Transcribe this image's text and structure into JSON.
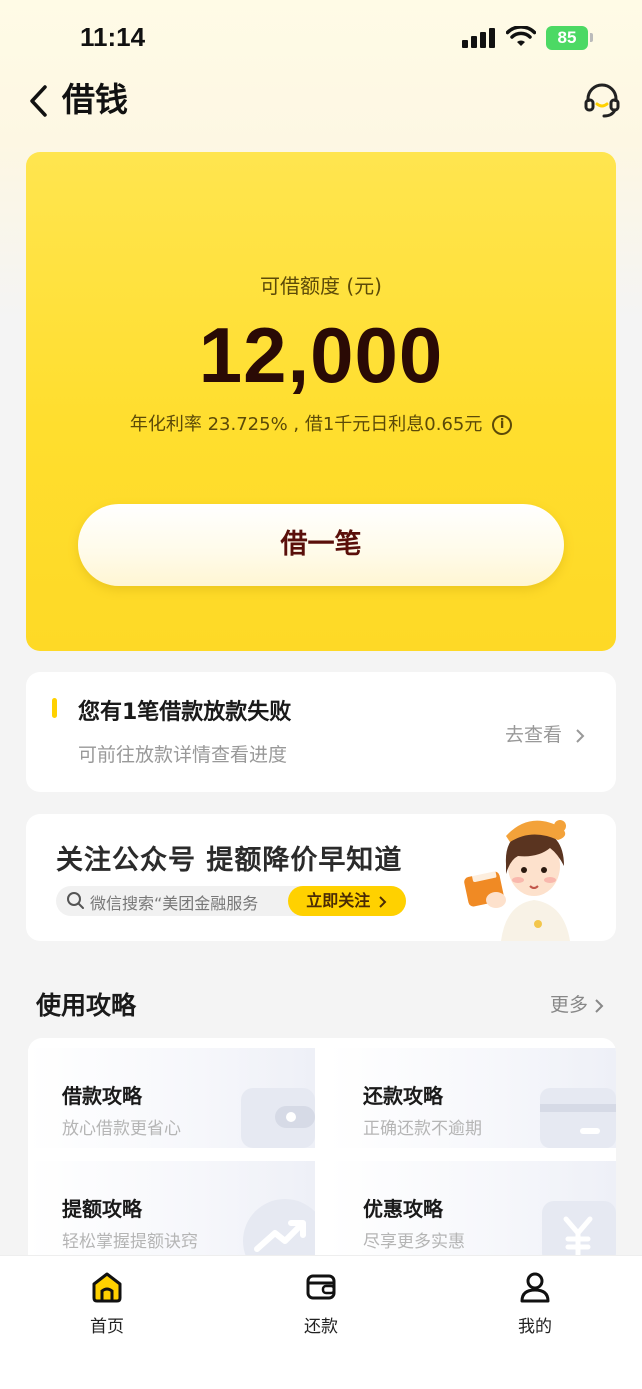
{
  "status_bar": {
    "time": "11:14",
    "battery": "85"
  },
  "nav": {
    "title": "借钱"
  },
  "credit": {
    "label": "可借额度 (元)",
    "amount": "12,000",
    "rate_text": "年化利率 23.725% , 借1千元日利息0.65元",
    "borrow_button": "借一笔"
  },
  "notice": {
    "title": "您有1笔借款放款失败",
    "subtitle": "可前往放款详情查看进度",
    "link": "去查看"
  },
  "banner": {
    "title": "关注公众号 提额降价早知道",
    "search_text": "微信搜索“美团金融服务",
    "follow_button": "立即关注"
  },
  "guides": {
    "section_title": "使用攻略",
    "more": "更多",
    "items": [
      {
        "title": "借款攻略",
        "subtitle": "放心借款更省心"
      },
      {
        "title": "还款攻略",
        "subtitle": "正确还款不逾期"
      },
      {
        "title": "提额攻略",
        "subtitle": "轻松掌握提额诀窍"
      },
      {
        "title": "优惠攻略",
        "subtitle": "尽享更多实惠"
      }
    ]
  },
  "tabbar": {
    "items": [
      {
        "label": "首页",
        "icon": "home-icon"
      },
      {
        "label": "还款",
        "icon": "wallet-icon"
      },
      {
        "label": "我的",
        "icon": "user-icon"
      }
    ]
  },
  "colors": {
    "accent": "#ffd100",
    "hero": "#ffde2e",
    "amount": "#2a0a05"
  }
}
